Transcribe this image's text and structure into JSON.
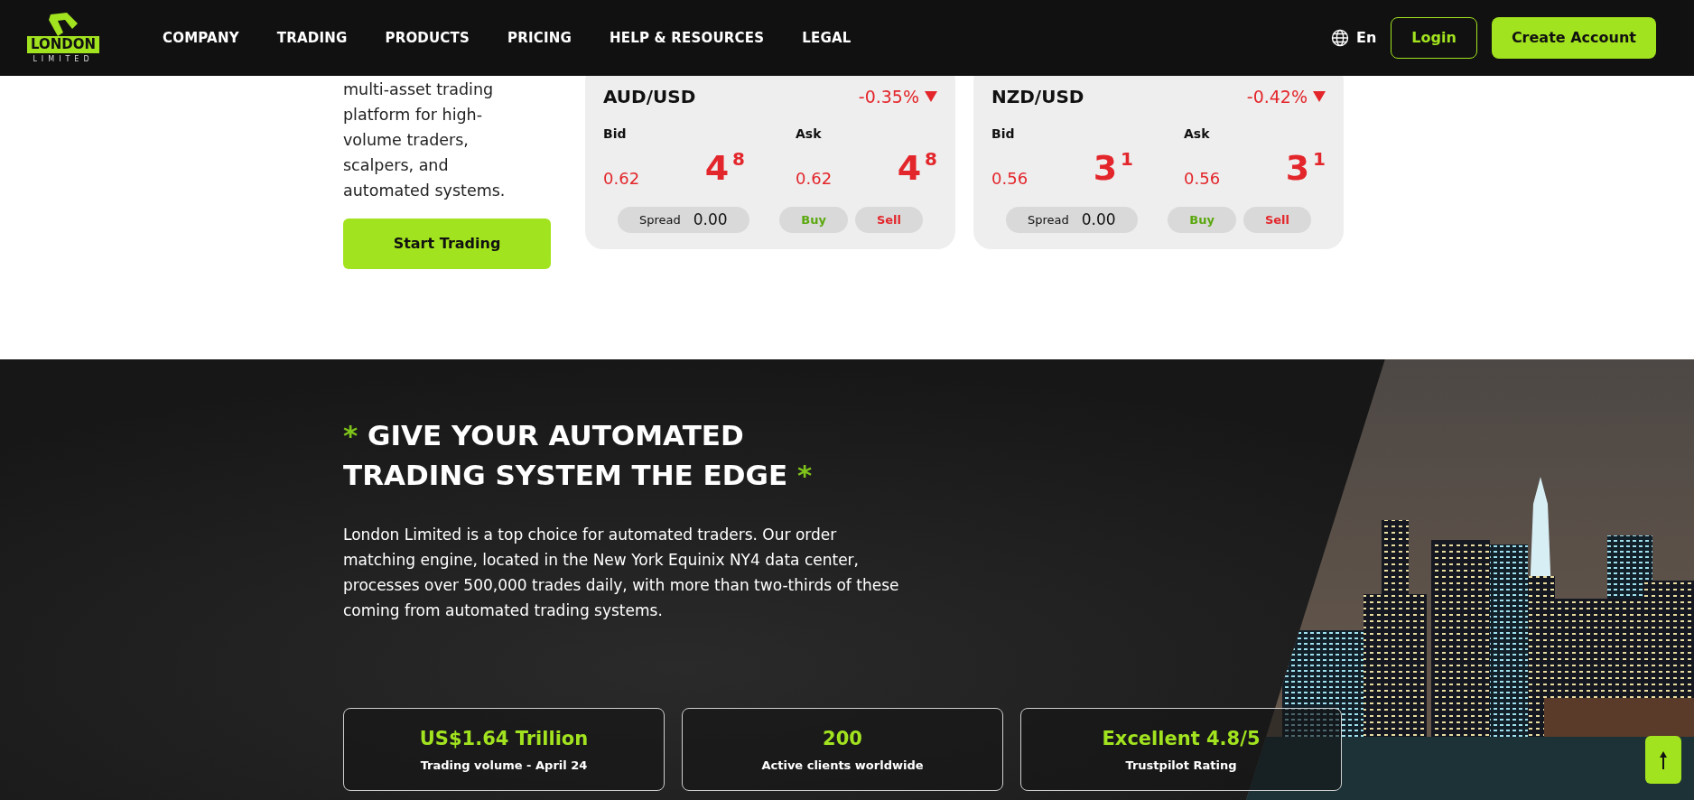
{
  "header": {
    "logo": {
      "name": "LONDON",
      "sub": "LIMITED"
    },
    "nav": [
      "COMPANY",
      "TRADING",
      "PRODUCTS",
      "PRICING",
      "HELP & RESOURCES",
      "LEGAL"
    ],
    "language": "En",
    "login": "Login",
    "create_account": "Create Account"
  },
  "hero": {
    "intro": "multi-asset trading platform for high-volume traders, scalpers, and automated systems.",
    "cta": "Start Trading",
    "quotes": [
      {
        "pair": "AUD/USD",
        "change": "-0.35%",
        "falling": true,
        "bid": {
          "label": "Bid",
          "price": "0.62",
          "pips": "4",
          "fraction": "8"
        },
        "ask": {
          "label": "Ask",
          "price": "0.62",
          "pips": "4",
          "fraction": "8"
        },
        "spread_label": "Spread",
        "spread": "0.00",
        "buy": "Buy",
        "sell": "Sell"
      },
      {
        "pair": "NZD/USD",
        "change": "-0.42%",
        "falling": true,
        "bid": {
          "label": "Bid",
          "price": "0.56",
          "pips": "3",
          "fraction": "1"
        },
        "ask": {
          "label": "Ask",
          "price": "0.56",
          "pips": "3",
          "fraction": "1"
        },
        "spread_label": "Spread",
        "spread": "0.00",
        "buy": "Buy",
        "sell": "Sell"
      }
    ]
  },
  "edge": {
    "mark_before": "*",
    "heading": "GIVE YOUR AUTOMATED TRADING SYSTEM THE EDGE",
    "mark_after": "*",
    "body": "London Limited is a top choice for automated traders. Our order matching engine, located in the New York Equinix NY4 data center, processes over 500,000 trades daily, with more than two-thirds of these coming from automated trading systems.",
    "stats": [
      {
        "value": "US$1.64 Trillion",
        "label": "Trading volume - April 24"
      },
      {
        "value": "200",
        "label": "Active clients worldwide"
      },
      {
        "value": "Excellent 4.8/5",
        "label": "Trustpilot Rating"
      }
    ]
  }
}
